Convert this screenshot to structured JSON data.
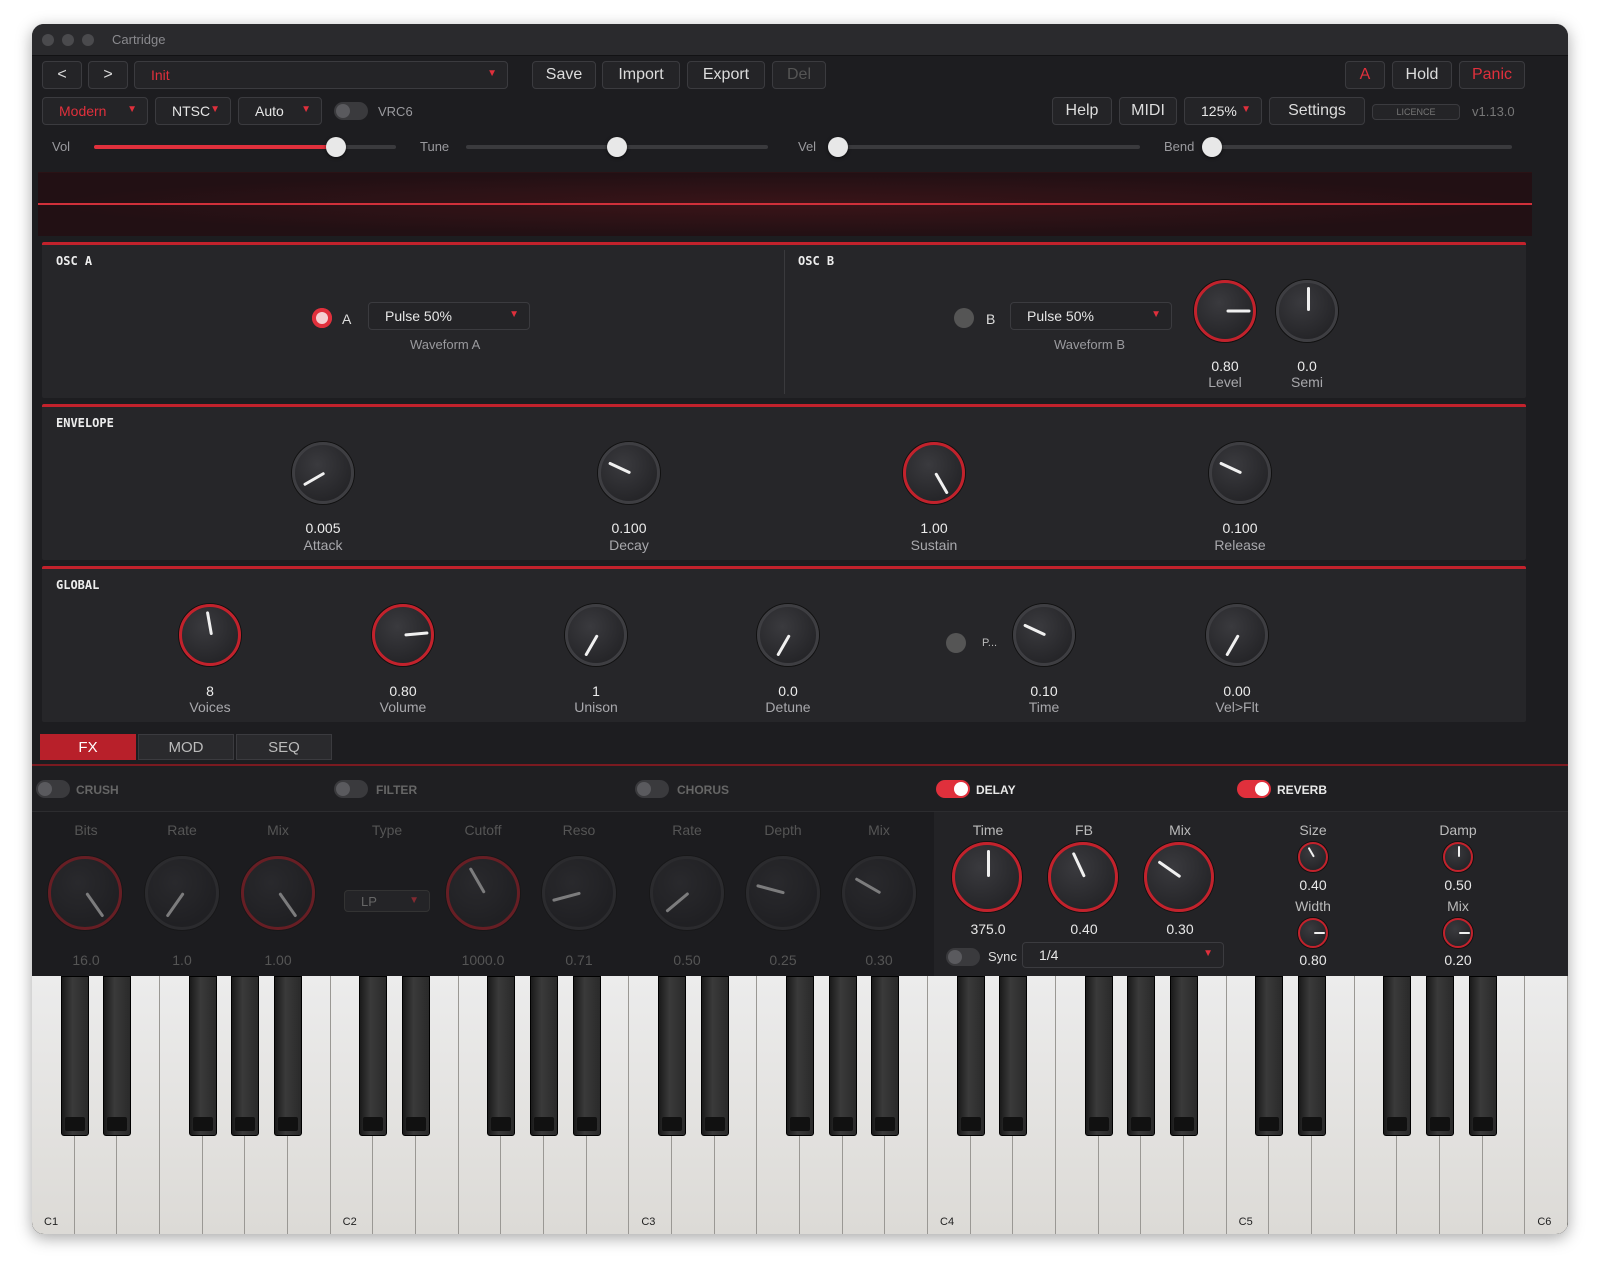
{
  "window": {
    "title": "Cartridge"
  },
  "toolbar1": {
    "prev": "<",
    "next": ">",
    "preset": "Init",
    "save": "Save",
    "import": "Import",
    "export": "Export",
    "del": "Del",
    "a": "A",
    "hold": "Hold",
    "panic": "Panic"
  },
  "toolbar2": {
    "mode": "Modern",
    "region": "NTSC",
    "auto": "Auto",
    "vrc6": "VRC6",
    "help": "Help",
    "midi": "MIDI",
    "zoom": "125%",
    "settings": "Settings",
    "licence": "LICENCE",
    "version": "v1.13.0"
  },
  "sliders": {
    "vol": {
      "label": "Vol",
      "value": 0.8
    },
    "tune": {
      "label": "Tune",
      "value": 0.5
    },
    "vel": {
      "label": "Vel",
      "value": 0.0
    },
    "bend": {
      "label": "Bend",
      "value": 0.0
    }
  },
  "osc_a": {
    "title": "OSC A",
    "toggle_label": "A",
    "waveform": "Pulse 50%",
    "waveform_label": "Waveform A"
  },
  "osc_b": {
    "title": "OSC B",
    "toggle_label": "B",
    "waveform": "Pulse 50%",
    "waveform_label": "Waveform B",
    "level": {
      "value": "0.80",
      "label": "Level"
    },
    "semi": {
      "value": "0.0",
      "label": "Semi"
    }
  },
  "envelope": {
    "title": "ENVELOPE",
    "attack": {
      "value": "0.005",
      "label": "Attack"
    },
    "decay": {
      "value": "0.100",
      "label": "Decay"
    },
    "sustain": {
      "value": "1.00",
      "label": "Sustain"
    },
    "release": {
      "value": "0.100",
      "label": "Release"
    }
  },
  "global": {
    "title": "GLOBAL",
    "voices": {
      "value": "8",
      "label": "Voices"
    },
    "volume": {
      "value": "0.80",
      "label": "Volume"
    },
    "unison": {
      "value": "1",
      "label": "Unison"
    },
    "detune": {
      "value": "0.0",
      "label": "Detune"
    },
    "porta_label": "P...",
    "time": {
      "value": "0.10",
      "label": "Time"
    },
    "velflt": {
      "value": "0.00",
      "label": "Vel>Flt"
    }
  },
  "tabs": [
    "FX",
    "MOD",
    "SEQ"
  ],
  "fx": {
    "crush": {
      "title": "CRUSH",
      "cols": [
        "Bits",
        "Rate",
        "Mix"
      ],
      "vals": [
        "16.0",
        "1.0",
        "1.00"
      ]
    },
    "filter": {
      "title": "FILTER",
      "cols": [
        "Type",
        "Cutoff",
        "Reso"
      ],
      "type": "LP",
      "vals": [
        "1000.0",
        "0.71"
      ]
    },
    "chorus": {
      "title": "CHORUS",
      "cols": [
        "Rate",
        "Depth",
        "Mix"
      ],
      "vals": [
        "0.50",
        "0.25",
        "0.30"
      ]
    },
    "delay": {
      "title": "DELAY",
      "cols": [
        "Time",
        "FB",
        "Mix"
      ],
      "vals": [
        "375.0",
        "0.40",
        "0.30"
      ],
      "sync": "Sync",
      "division": "1/4"
    },
    "reverb": {
      "title": "REVERB",
      "size": {
        "label": "Size",
        "value": "0.40"
      },
      "damp": {
        "label": "Damp",
        "value": "0.50"
      },
      "width": {
        "label": "Width",
        "value": "0.80"
      },
      "mix": {
        "label": "Mix",
        "value": "0.20"
      }
    }
  },
  "piano": {
    "labels": [
      "C1",
      "C2",
      "C3",
      "C4",
      "C5",
      "C6"
    ]
  },
  "colors": {
    "accent": "#e0303c",
    "bg": "#1d1d20",
    "panel": "#262629"
  }
}
